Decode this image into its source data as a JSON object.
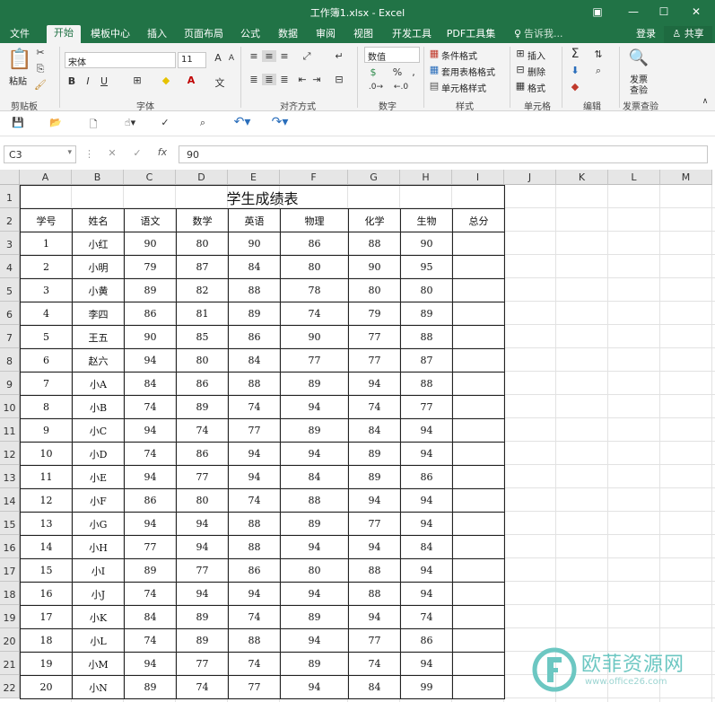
{
  "window": {
    "title": "工作簿1.xlsx - Excel"
  },
  "ribbon_tabs": [
    "文件",
    "开始",
    "模板中心",
    "插入",
    "页面布局",
    "公式",
    "数据",
    "审阅",
    "视图",
    "开发工具",
    "PDF工具集"
  ],
  "tell_me": "告诉我...",
  "account": {
    "login": "登录",
    "share": "共享"
  },
  "ribbon": {
    "clipboard": {
      "paste": "粘贴",
      "label": "剪贴板"
    },
    "font": {
      "name": "宋体",
      "size": "11",
      "label": "字体",
      "bold": "B",
      "italic": "I",
      "underline": "U"
    },
    "alignment": {
      "label": "对齐方式"
    },
    "number": {
      "format": "数值",
      "label": "数字"
    },
    "styles": {
      "conditional": "条件格式",
      "table": "套用表格格式",
      "cell": "单元格样式",
      "label": "样式"
    },
    "cells": {
      "insert": "插入",
      "delete": "删除",
      "format": "格式",
      "label": "单元格"
    },
    "editing": {
      "label": "编辑"
    },
    "invoice": {
      "check1": "发票",
      "check2": "查验",
      "label": "发票查验"
    }
  },
  "formula_bar": {
    "cell_ref": "C3",
    "formula": "90"
  },
  "columns": [
    "A",
    "B",
    "C",
    "D",
    "E",
    "F",
    "G",
    "H",
    "I",
    "J",
    "K",
    "L",
    "M"
  ],
  "rows": [
    "1",
    "2",
    "3",
    "4",
    "5",
    "6",
    "7",
    "8",
    "9",
    "10",
    "11",
    "12",
    "13",
    "14",
    "15",
    "16",
    "17",
    "18",
    "19",
    "20",
    "21",
    "22"
  ],
  "sheet": {
    "title": "学生成绩表",
    "headers": [
      "学号",
      "姓名",
      "语文",
      "数学",
      "英语",
      "物理",
      "化学",
      "生物",
      "总分"
    ],
    "data": [
      [
        "1",
        "小红",
        "90",
        "80",
        "90",
        "86",
        "88",
        "90"
      ],
      [
        "2",
        "小明",
        "79",
        "87",
        "84",
        "80",
        "90",
        "95"
      ],
      [
        "3",
        "小黄",
        "89",
        "82",
        "88",
        "78",
        "80",
        "80"
      ],
      [
        "4",
        "李四",
        "86",
        "81",
        "89",
        "74",
        "79",
        "89"
      ],
      [
        "5",
        "王五",
        "90",
        "85",
        "86",
        "90",
        "77",
        "88"
      ],
      [
        "6",
        "赵六",
        "94",
        "80",
        "84",
        "77",
        "77",
        "87"
      ],
      [
        "7",
        "小A",
        "84",
        "86",
        "88",
        "89",
        "94",
        "88"
      ],
      [
        "8",
        "小B",
        "74",
        "89",
        "74",
        "94",
        "74",
        "77"
      ],
      [
        "9",
        "小C",
        "94",
        "74",
        "77",
        "89",
        "84",
        "94"
      ],
      [
        "10",
        "小D",
        "74",
        "86",
        "94",
        "94",
        "89",
        "94"
      ],
      [
        "11",
        "小E",
        "94",
        "77",
        "94",
        "84",
        "89",
        "86"
      ],
      [
        "12",
        "小F",
        "86",
        "80",
        "74",
        "88",
        "94",
        "94"
      ],
      [
        "13",
        "小G",
        "94",
        "94",
        "88",
        "89",
        "77",
        "94"
      ],
      [
        "14",
        "小H",
        "77",
        "94",
        "88",
        "94",
        "94",
        "84"
      ],
      [
        "15",
        "小I",
        "89",
        "77",
        "86",
        "80",
        "88",
        "94"
      ],
      [
        "16",
        "小J",
        "74",
        "94",
        "94",
        "94",
        "88",
        "94"
      ],
      [
        "17",
        "小K",
        "84",
        "89",
        "74",
        "89",
        "94",
        "74"
      ],
      [
        "18",
        "小L",
        "74",
        "89",
        "88",
        "94",
        "77",
        "86"
      ],
      [
        "19",
        "小M",
        "94",
        "77",
        "74",
        "89",
        "74",
        "94"
      ],
      [
        "20",
        "小N",
        "89",
        "74",
        "77",
        "94",
        "84",
        "99"
      ]
    ]
  },
  "watermark": {
    "text": "欧菲资源网",
    "url": "www.office26.com"
  }
}
